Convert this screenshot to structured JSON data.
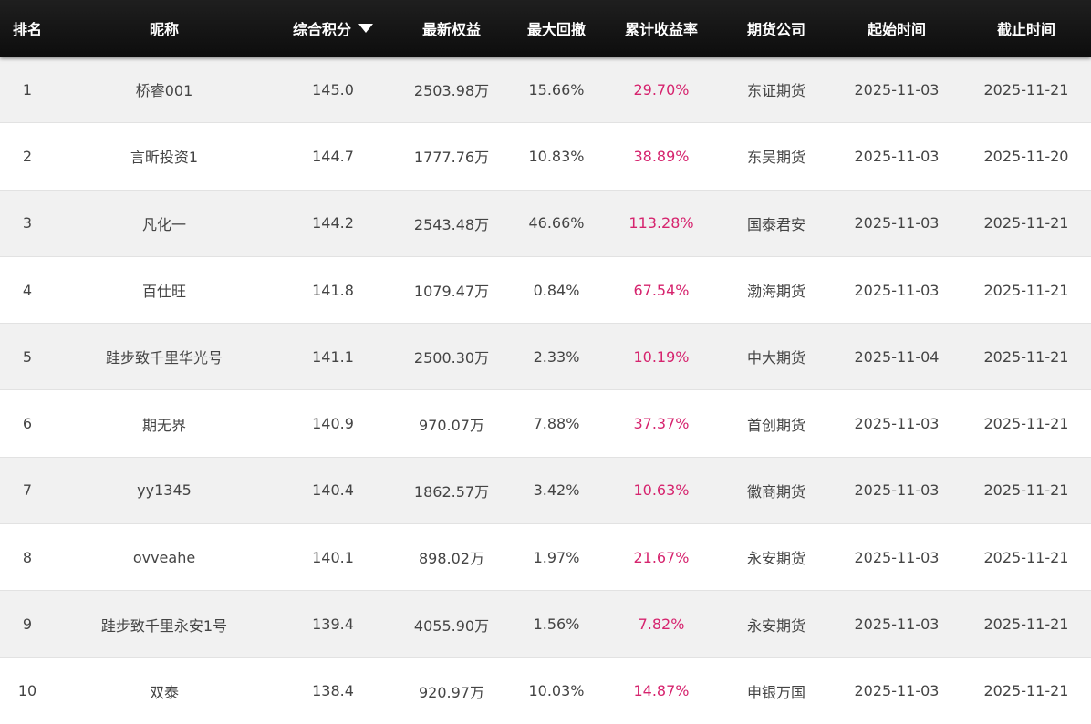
{
  "header": {
    "rank": "排名",
    "name": "昵称",
    "score": "综合积分",
    "sort_icon": "triangle-down",
    "equity": "最新权益",
    "drawdown": "最大回撤",
    "return": "累计收益率",
    "company": "期货公司",
    "start": "起始时间",
    "end": "截止时间"
  },
  "colors": {
    "header_bg": "#111111",
    "header_text": "#ffffff",
    "return_text": "#d6246e",
    "row_alt_bg": "#f1f1f1"
  },
  "rows": [
    {
      "rank": "1",
      "name": "桥睿001",
      "score": "145.0",
      "equity": "2503.98万",
      "drawdown": "15.66%",
      "return": "29.70%",
      "company": "东证期货",
      "start": "2025-11-03",
      "end": "2025-11-21"
    },
    {
      "rank": "2",
      "name": "言昕投资1",
      "score": "144.7",
      "equity": "1777.76万",
      "drawdown": "10.83%",
      "return": "38.89%",
      "company": "东吴期货",
      "start": "2025-11-03",
      "end": "2025-11-20"
    },
    {
      "rank": "3",
      "name": "凡化一",
      "score": "144.2",
      "equity": "2543.48万",
      "drawdown": "46.66%",
      "return": "113.28%",
      "company": "国泰君安",
      "start": "2025-11-03",
      "end": "2025-11-21"
    },
    {
      "rank": "4",
      "name": "百仕旺",
      "score": "141.8",
      "equity": "1079.47万",
      "drawdown": "0.84%",
      "return": "67.54%",
      "company": "渤海期货",
      "start": "2025-11-03",
      "end": "2025-11-21"
    },
    {
      "rank": "5",
      "name": "跬步致千里华光号",
      "score": "141.1",
      "equity": "2500.30万",
      "drawdown": "2.33%",
      "return": "10.19%",
      "company": "中大期货",
      "start": "2025-11-04",
      "end": "2025-11-21"
    },
    {
      "rank": "6",
      "name": "期无界",
      "score": "140.9",
      "equity": "970.07万",
      "drawdown": "7.88%",
      "return": "37.37%",
      "company": "首创期货",
      "start": "2025-11-03",
      "end": "2025-11-21"
    },
    {
      "rank": "7",
      "name": "yy1345",
      "score": "140.4",
      "equity": "1862.57万",
      "drawdown": "3.42%",
      "return": "10.63%",
      "company": "徽商期货",
      "start": "2025-11-03",
      "end": "2025-11-21"
    },
    {
      "rank": "8",
      "name": "ovveahe",
      "score": "140.1",
      "equity": "898.02万",
      "drawdown": "1.97%",
      "return": "21.67%",
      "company": "永安期货",
      "start": "2025-11-03",
      "end": "2025-11-21"
    },
    {
      "rank": "9",
      "name": "跬步致千里永安1号",
      "score": "139.4",
      "equity": "4055.90万",
      "drawdown": "1.56%",
      "return": "7.82%",
      "company": "永安期货",
      "start": "2025-11-03",
      "end": "2025-11-21"
    },
    {
      "rank": "10",
      "name": "双泰",
      "score": "138.4",
      "equity": "920.97万",
      "drawdown": "10.03%",
      "return": "14.87%",
      "company": "申银万国",
      "start": "2025-11-03",
      "end": "2025-11-21"
    }
  ]
}
